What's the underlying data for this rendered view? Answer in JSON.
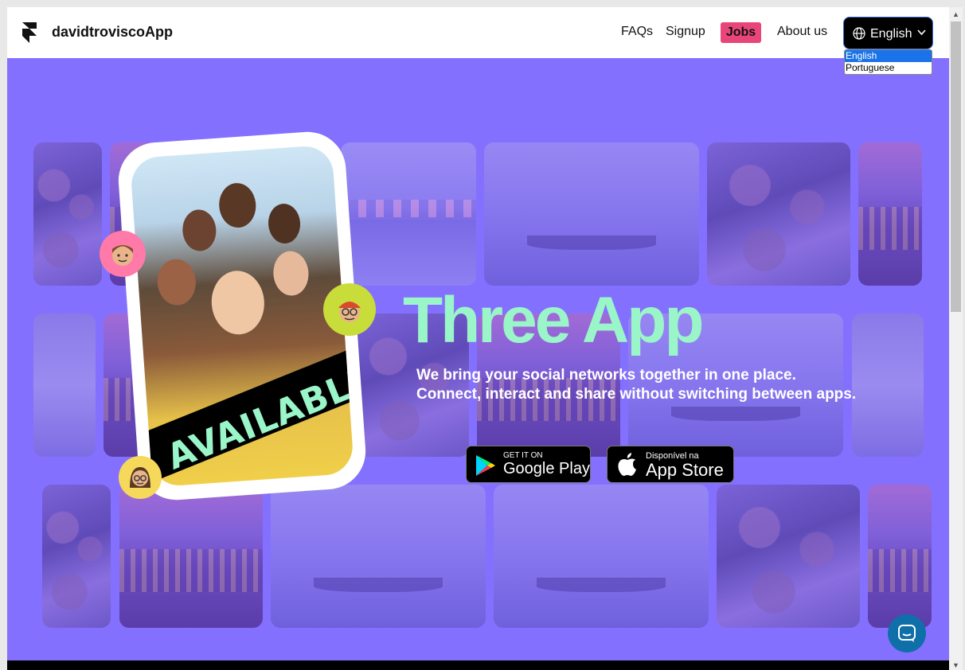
{
  "header": {
    "brand": "davidtroviscoApp",
    "nav": [
      {
        "label": "FAQs"
      },
      {
        "label": "Signup"
      },
      {
        "label": "Jobs"
      },
      {
        "label": "About us"
      }
    ],
    "language": {
      "current": "English",
      "options": [
        "English",
        "Portuguese"
      ]
    }
  },
  "hero": {
    "badge": "AVAILABLE",
    "title": "Three App",
    "subtitle_line1": "We bring your social networks together in one place.",
    "subtitle_line2": "Connect, interact and share without switching between apps."
  },
  "stores": {
    "google": {
      "small": "GET IT ON",
      "big": "Google Play"
    },
    "apple": {
      "small": "Disponível na",
      "big": "App Store"
    }
  },
  "colors": {
    "background": "#8470ff",
    "accent_green": "#9af5c9",
    "jobs_highlight": "#e8457a"
  },
  "icons": {
    "logo": "framer-logo-icon",
    "globe": "globe-icon",
    "chevron": "chevron-down-icon",
    "chat": "chat-icon"
  }
}
